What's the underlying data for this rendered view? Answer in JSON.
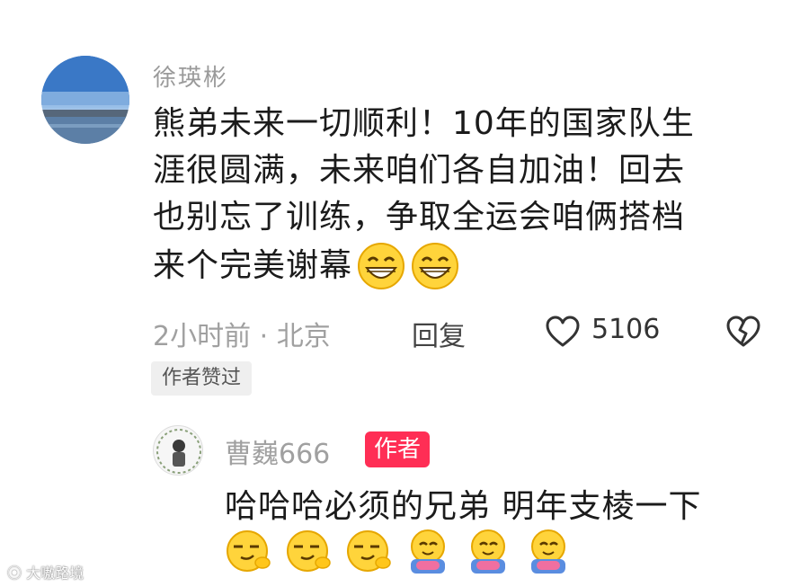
{
  "comment": {
    "username": "徐瑛彬",
    "text": "熊弟未来一切顺利！10年的国家队生涯很圆满，未来咱们各自加油！回去也别忘了训练，争取全运会咱俩搭档来个完美谢幕",
    "lines": [
      "熊弟未来一切顺利！10年的国家队生",
      "涯很圆满，未来咱们各自加油！回去",
      "也别忘了训练，争取全运会咱俩搭档",
      "来个完美谢幕"
    ],
    "emojis": [
      "grin-emoji",
      "grin-emoji"
    ],
    "time_location": "2小时前 · 北京",
    "reply_label": "回复",
    "like_count": "5106",
    "author_liked_tag": "作者赞过"
  },
  "reply": {
    "username": "曹巍666",
    "author_badge": "作者",
    "text": "哈哈哈必须的兄弟 明年支棱一下",
    "emojis": [
      "smirk-emoji",
      "smirk-emoji",
      "smirk-emoji",
      "hug-emoji",
      "hug-emoji",
      "hug-emoji"
    ]
  },
  "watermark": "大嗷路境",
  "colors": {
    "badge": "#ff2e55",
    "meta": "#a0a0a0",
    "text": "#1b1b1b"
  }
}
